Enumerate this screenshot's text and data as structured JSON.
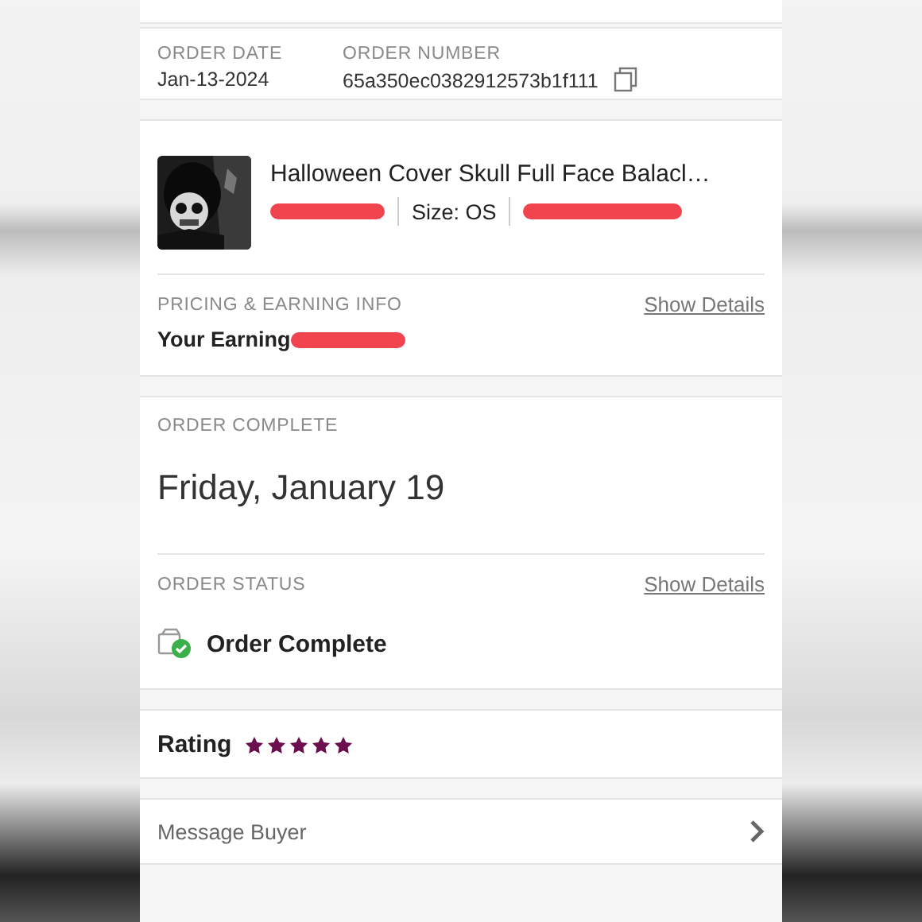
{
  "order_info": {
    "date_label": "ORDER DATE",
    "date": "Jan-13-2024",
    "number_label": "ORDER NUMBER",
    "number": "65a350ec0382912573b1f111"
  },
  "product": {
    "kind": "picture",
    "title": "Halloween Cover Skull Full Face Balacl…",
    "price_redacted": true,
    "size": "Size: OS",
    "extra_redacted": true
  },
  "pricing": {
    "label": "PRICING & EARNING INFO",
    "link": "Show Details",
    "earning": "Your Earning",
    "earning_redacted": true
  },
  "completion": {
    "label": "ORDER COMPLETE",
    "date": "Friday, January 19"
  },
  "status": {
    "label": "ORDER STATUS",
    "link": "Show Details",
    "text": "Order Complete"
  },
  "rating": {
    "label": "Rating",
    "stars": 5
  },
  "message": {
    "label": "Message Buyer"
  }
}
